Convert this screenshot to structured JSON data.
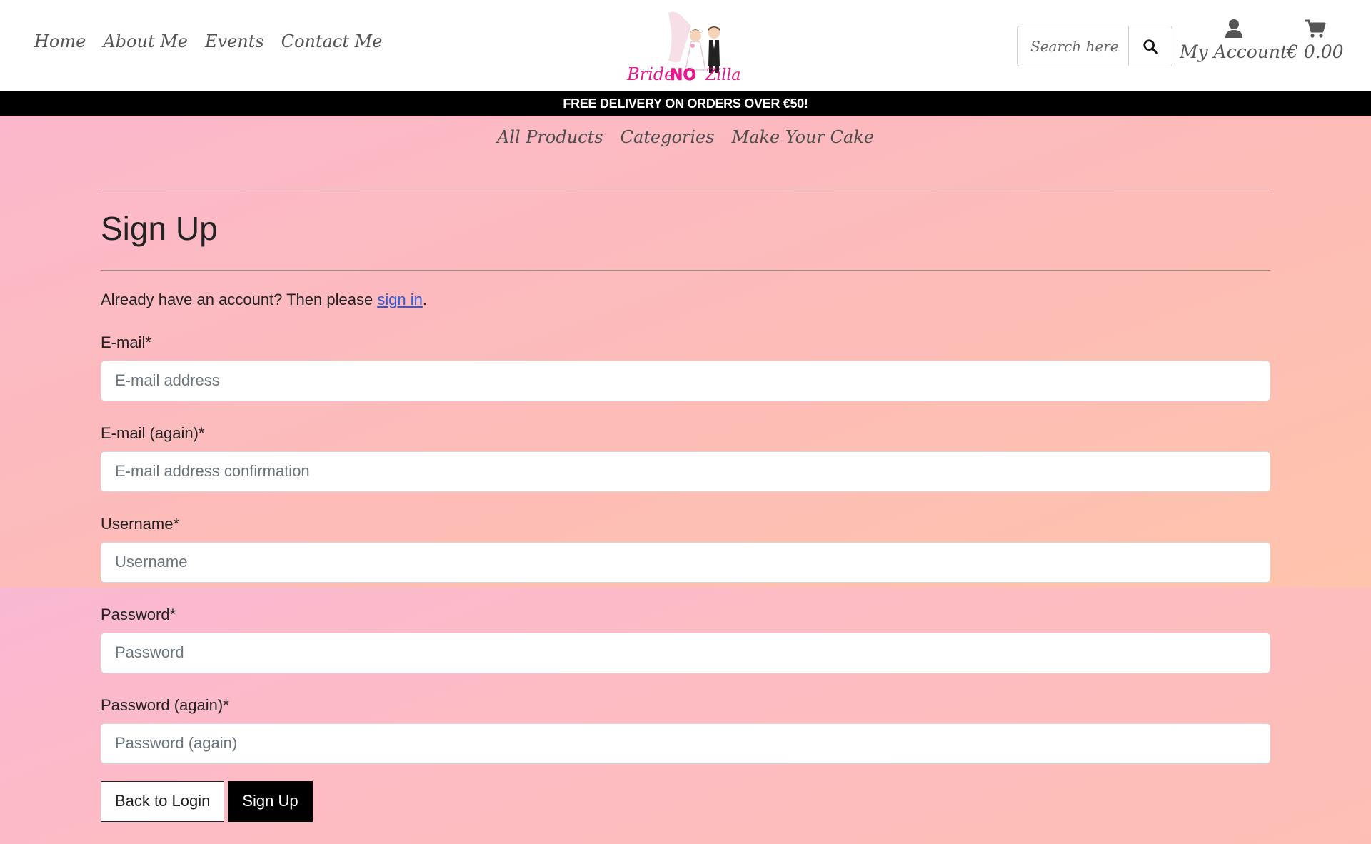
{
  "nav": {
    "items": [
      {
        "label": "Home"
      },
      {
        "label": "About Me"
      },
      {
        "label": "Events"
      },
      {
        "label": "Contact Me"
      }
    ]
  },
  "logo": {
    "text_left": "Bride",
    "text_mid": "NO",
    "text_right": "Zilla",
    "brand_color": "#e8188c"
  },
  "search": {
    "placeholder": "Search here",
    "icon": "search-icon"
  },
  "account": {
    "label": "My Account",
    "icon": "user-icon"
  },
  "cart": {
    "total": "€ 0.00",
    "icon": "cart-icon"
  },
  "banner": {
    "text": "FREE DELIVERY ON ORDERS OVER €50!"
  },
  "subnav": {
    "items": [
      {
        "label": "All Products"
      },
      {
        "label": "Categories"
      },
      {
        "label": "Make Your Cake"
      }
    ]
  },
  "form": {
    "title": "Sign Up",
    "signin_prefix": "Already have an account? Then please ",
    "signin_link": "sign in",
    "signin_suffix": ".",
    "fields": [
      {
        "label": "E-mail*",
        "placeholder": "E-mail address",
        "value": ""
      },
      {
        "label": "E-mail (again)*",
        "placeholder": "E-mail address confirmation",
        "value": ""
      },
      {
        "label": "Username*",
        "placeholder": "Username",
        "value": ""
      },
      {
        "label": "Password*",
        "placeholder": "Password",
        "value": ""
      },
      {
        "label": "Password (again)*",
        "placeholder": "Password (again)",
        "value": ""
      }
    ],
    "back_button": "Back to Login",
    "submit_button": "Sign Up"
  },
  "colors": {
    "banner_bg": "#000000",
    "link": "#2b5cde",
    "gradient_start": "#fbb8cc",
    "gradient_end": "#fec9a6"
  }
}
